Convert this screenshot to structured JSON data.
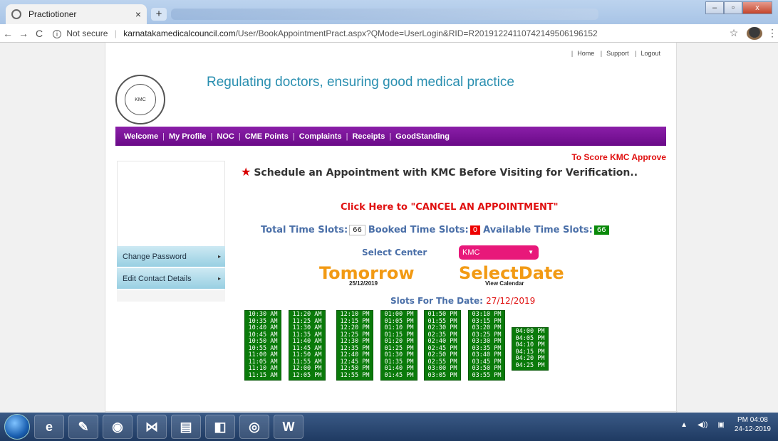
{
  "browser": {
    "tab_title": "Practiotioner",
    "tab_close": "×",
    "new_tab": "+",
    "nav_back": "←",
    "nav_forward": "→",
    "nav_reload": "C",
    "security_label": "Not secure",
    "url_host": "karnatakamedicalcouncil.com",
    "url_path": "/User/BookAppointmentPract.aspx?QMode=UserLogin&RID=R20191224110742149506196152",
    "bookmark_icon": "☆",
    "menu_icon": "⋮",
    "win_min": "–",
    "win_max": "▫",
    "win_close": "x"
  },
  "header": {
    "top_links": [
      "Home",
      "Support",
      "Logout"
    ],
    "tagline": "Regulating doctors, ensuring good medical practice",
    "logo_text": "KMC"
  },
  "menu": {
    "items": [
      "Welcome",
      "My Profile",
      "NOC",
      "CME Points",
      "Complaints",
      "Receipts",
      "GoodStanding"
    ]
  },
  "score_link": "To Score KMC Approve",
  "sidebar": {
    "items": [
      "Change Password",
      "Edit Contact Details"
    ]
  },
  "main": {
    "schedule_star": "★",
    "schedule_text": "Schedule an Appointment with KMC Before Visiting for Verification..",
    "cancel_link": "Click Here to \"CANCEL AN APPOINTMENT\"",
    "total_label": "Total Time Slots:",
    "total_value": "66",
    "booked_label": "Booked Time Slots:",
    "booked_value": "0",
    "available_label": "Available Time Slots:",
    "available_value": "66",
    "center_label": "Select Center",
    "center_value": "KMC",
    "tomorrow_label": "Tomorrow",
    "tomorrow_date": "25/12/2019",
    "select_date_label": "SelectDate",
    "view_calendar": "View Calendar",
    "slots_label": "Slots For The Date:",
    "slots_date": "27/12/2019"
  },
  "slots": [
    [
      "10:30 AM",
      "10:35 AM",
      "10:40 AM",
      "10:45 AM",
      "10:50 AM",
      "10:55 AM",
      "11:00 AM",
      "11:05 AM",
      "11:10 AM",
      "11:15 AM"
    ],
    [
      "11:20 AM",
      "11:25 AM",
      "11:30 AM",
      "11:35 AM",
      "11:40 AM",
      "11:45 AM",
      "11:50 AM",
      "11:55 AM",
      "12:00 PM",
      "12:05 PM"
    ],
    [
      "12:10 PM",
      "12:15 PM",
      "12:20 PM",
      "12:25 PM",
      "12:30 PM",
      "12:35 PM",
      "12:40 PM",
      "12:45 PM",
      "12:50 PM",
      "12:55 PM"
    ],
    [
      "01:00 PM",
      "01:05 PM",
      "01:10 PM",
      "01:15 PM",
      "01:20 PM",
      "01:25 PM",
      "01:30 PM",
      "01:35 PM",
      "01:40 PM",
      "01:45 PM"
    ],
    [
      "01:50 PM",
      "01:55 PM",
      "02:30 PM",
      "02:35 PM",
      "02:40 PM",
      "02:45 PM",
      "02:50 PM",
      "02:55 PM",
      "03:00 PM",
      "03:05 PM"
    ],
    [
      "03:10 PM",
      "03:15 PM",
      "03:20 PM",
      "03:25 PM",
      "03:30 PM",
      "03:35 PM",
      "03:40 PM",
      "03:45 PM",
      "03:50 PM",
      "03:55 PM"
    ],
    [
      "04:00 PM",
      "04:05 PM",
      "04:10 PM",
      "04:15 PM",
      "04:20 PM",
      "04:25 PM"
    ]
  ],
  "taskbar": {
    "apps": [
      "e",
      "✎",
      "◉",
      "⋈",
      "▤",
      "◧",
      "◎",
      "W"
    ],
    "clock_time": "PM 04:08",
    "clock_date": "24-12-2019"
  }
}
